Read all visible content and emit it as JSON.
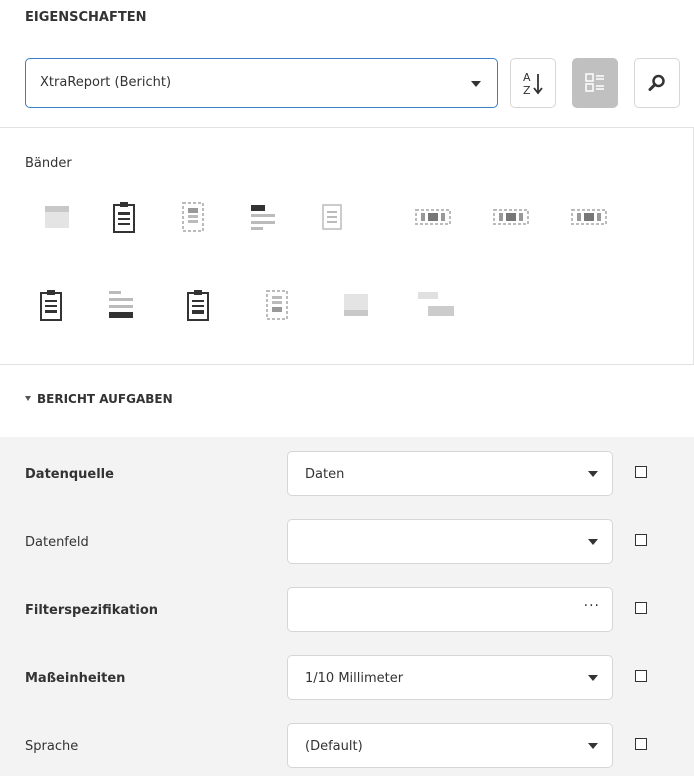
{
  "panel": {
    "title": "EIGENSCHAFTEN"
  },
  "toolbar": {
    "component_value": "XtraReport (Bericht)",
    "sort_icon": "sort-az-icon",
    "categories_icon": "categories-icon",
    "search_icon": "search-icon"
  },
  "bands": {
    "label": "Bänder",
    "row1": [
      "top-margin-band-icon",
      "report-header-band-icon",
      "page-header-band-icon",
      "group-header-band-icon",
      "detail-band-icon",
      "detail-report-band-icon",
      "sub-band-icon",
      "vertical-band-icon"
    ],
    "row2": [
      "report-footer-band-icon",
      "group-footer-band-icon",
      "page-footer-band-icon",
      "vertical-total-band-icon",
      "bottom-margin-band-icon",
      "vertical-header-band-icon"
    ]
  },
  "tasks": {
    "header": "BERICHT AUFGABEN",
    "properties": [
      {
        "label": "Datenquelle",
        "value": "Daten",
        "editor": "dropdown",
        "bold": true
      },
      {
        "label": "Datenfeld",
        "value": "",
        "editor": "dropdown",
        "bold": false
      },
      {
        "label": "Filterspezifikation",
        "value": "",
        "editor": "ellipsis",
        "ellipsis": "···",
        "bold": true
      },
      {
        "label": "Maßeinheiten",
        "value": "1/10 Millimeter",
        "editor": "dropdown",
        "bold": true
      },
      {
        "label": "Sprache",
        "value": "(Default)",
        "editor": "dropdown",
        "bold": false
      }
    ]
  },
  "colors": {
    "accent": "#3b7fc4",
    "icon_dark": "#333333",
    "icon_light": "#c8c8c8",
    "props_bg": "#f3f3f3"
  }
}
